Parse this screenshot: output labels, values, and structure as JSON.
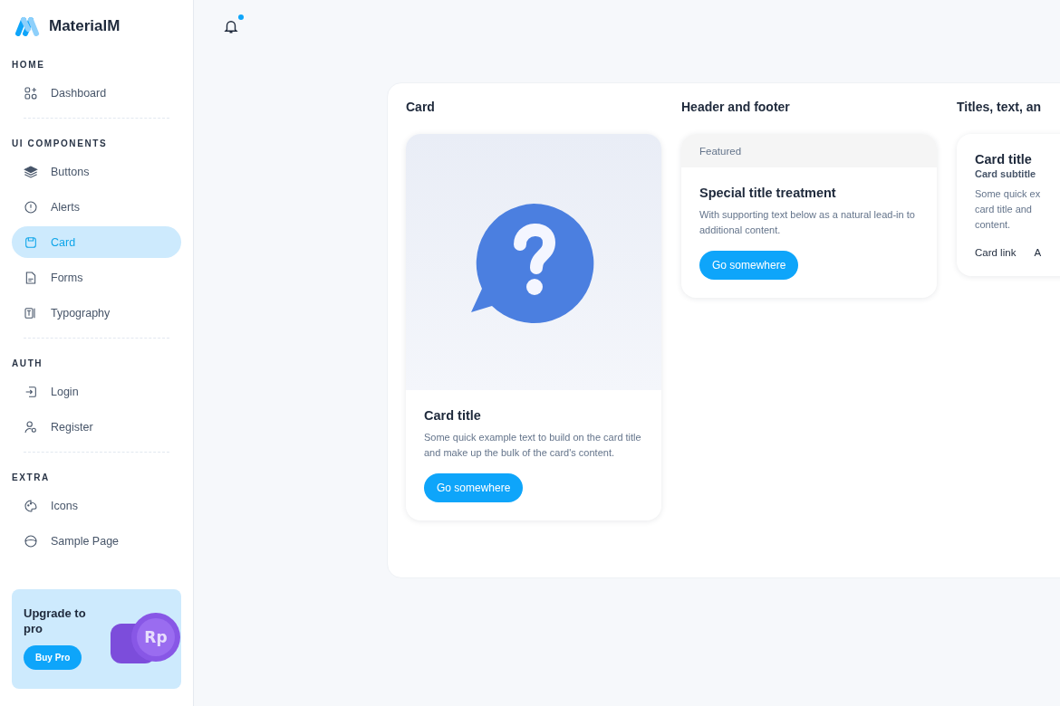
{
  "brand": {
    "name": "MaterialM"
  },
  "sidebar": {
    "sections": [
      {
        "title": "HOME",
        "items": [
          {
            "label": "Dashboard",
            "selected": false
          }
        ]
      },
      {
        "title": "UI COMPONENTS",
        "items": [
          {
            "label": "Buttons",
            "selected": false
          },
          {
            "label": "Alerts",
            "selected": false
          },
          {
            "label": "Card",
            "selected": true
          },
          {
            "label": "Forms",
            "selected": false
          },
          {
            "label": "Typography",
            "selected": false
          }
        ]
      },
      {
        "title": "AUTH",
        "items": [
          {
            "label": "Login",
            "selected": false
          },
          {
            "label": "Register",
            "selected": false
          }
        ]
      },
      {
        "title": "EXTRA",
        "items": [
          {
            "label": "Icons",
            "selected": false
          },
          {
            "label": "Sample Page",
            "selected": false
          }
        ]
      }
    ]
  },
  "upgrade": {
    "title": "Upgrade to pro",
    "button": "Buy Pro",
    "coin": "Rp"
  },
  "topbar": {
    "notification_dot": true
  },
  "sections": [
    {
      "kind": "image",
      "heading": "Card",
      "title": "Card title",
      "text": "Some quick example text to build on the card title and make up the bulk of the card's content.",
      "button": "Go somewhere"
    },
    {
      "kind": "header",
      "heading": "Header and footer",
      "header": "Featured",
      "title": "Special title treatment",
      "text": "With supporting text below as a natural lead-in to additional content.",
      "button": "Go somewhere"
    },
    {
      "kind": "links",
      "heading": "Titles, text, an",
      "title": "Card title",
      "subtitle": "Card subtitle",
      "lines": [
        "Some quick ex",
        "card title and",
        "content."
      ],
      "links": [
        "Card link",
        "A"
      ]
    }
  ]
}
